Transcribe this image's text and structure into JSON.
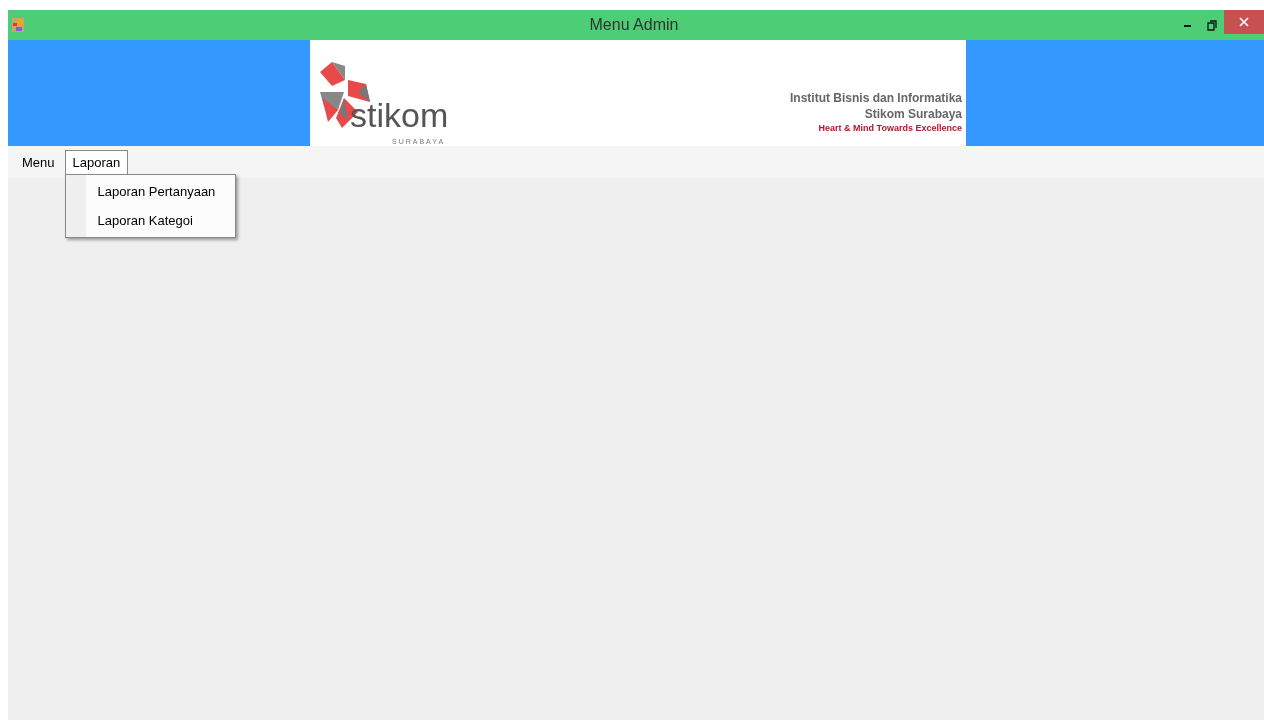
{
  "window": {
    "title": "Menu Admin"
  },
  "banner": {
    "logo_word": "stikom",
    "logo_sub": "SURABAYA",
    "lines": [
      "Institut Bisnis dan Informatika",
      "Stikom Surabaya"
    ],
    "tagline": "Heart & Mind Towards Excellence"
  },
  "menu": [
    {
      "label": "Menu",
      "selected": false
    },
    {
      "label": "Laporan",
      "selected": true,
      "items": [
        "Laporan Pertanyaan",
        "Laporan Kategoi"
      ]
    }
  ]
}
